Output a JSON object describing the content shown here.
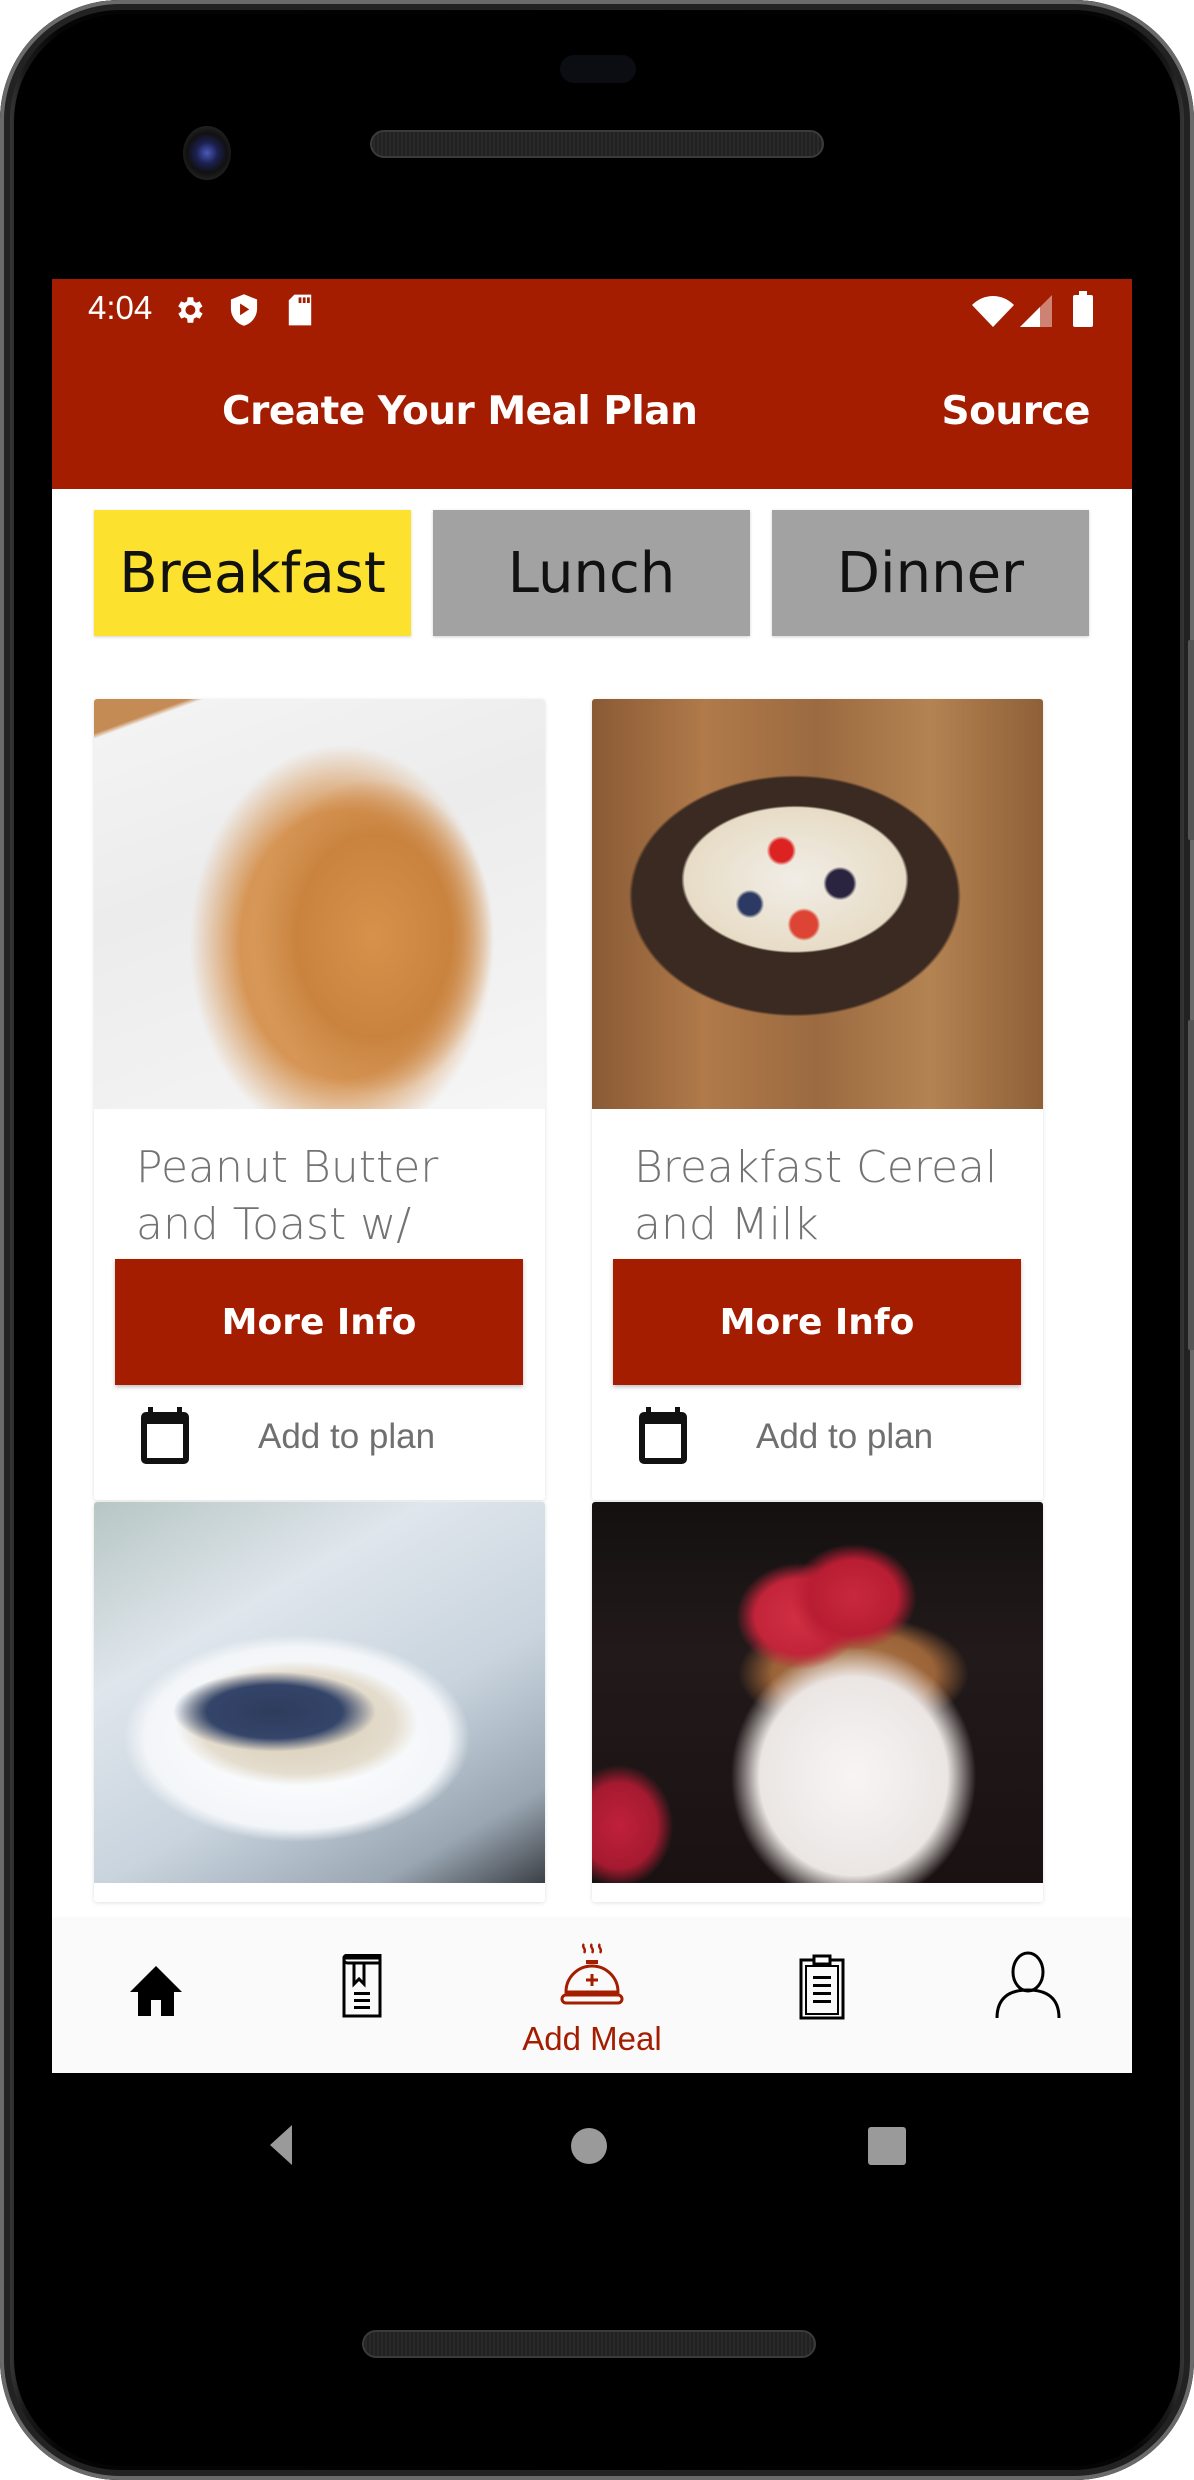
{
  "status_bar": {
    "time": "4:04",
    "left_icons": [
      "gear-icon",
      "shield-play-icon",
      "sd-card-icon"
    ],
    "right_icons": [
      "wifi-icon",
      "signal-icon",
      "battery-icon"
    ]
  },
  "app_bar": {
    "title": "Create Your Meal Plan",
    "action_label": "Source"
  },
  "colors": {
    "brand": "#a51d00",
    "active_tab": "#fce22e",
    "inactive_tab": "#a2a2a2",
    "nav_bg": "#fafafa"
  },
  "tabs": [
    {
      "label": "Breakfast",
      "active": true
    },
    {
      "label": "Lunch",
      "active": false
    },
    {
      "label": "Dinner",
      "active": false
    }
  ],
  "meals": [
    {
      "title": "Peanut Butter and Toast w/",
      "image": "peanut-butter-toast",
      "button_label": "More Info",
      "add_label": "Add to plan"
    },
    {
      "title": "Breakfast Cereal and Milk",
      "image": "cereal-with-berries",
      "button_label": "More Info",
      "add_label": "Add to plan"
    },
    {
      "title": "",
      "image": "oatmeal-with-blueberries"
    },
    {
      "title": "",
      "image": "yogurt-parfait-with-raspberries"
    }
  ],
  "bottom_nav": {
    "items": [
      {
        "icon": "home-icon",
        "label": ""
      },
      {
        "icon": "recipe-book-icon",
        "label": ""
      },
      {
        "icon": "add-meal-cloche-icon",
        "label": "Add Meal",
        "active": true
      },
      {
        "icon": "clipboard-icon",
        "label": ""
      },
      {
        "icon": "profile-icon",
        "label": ""
      }
    ]
  },
  "system_nav": [
    "back-icon",
    "home-circle-icon",
    "recents-icon"
  ]
}
